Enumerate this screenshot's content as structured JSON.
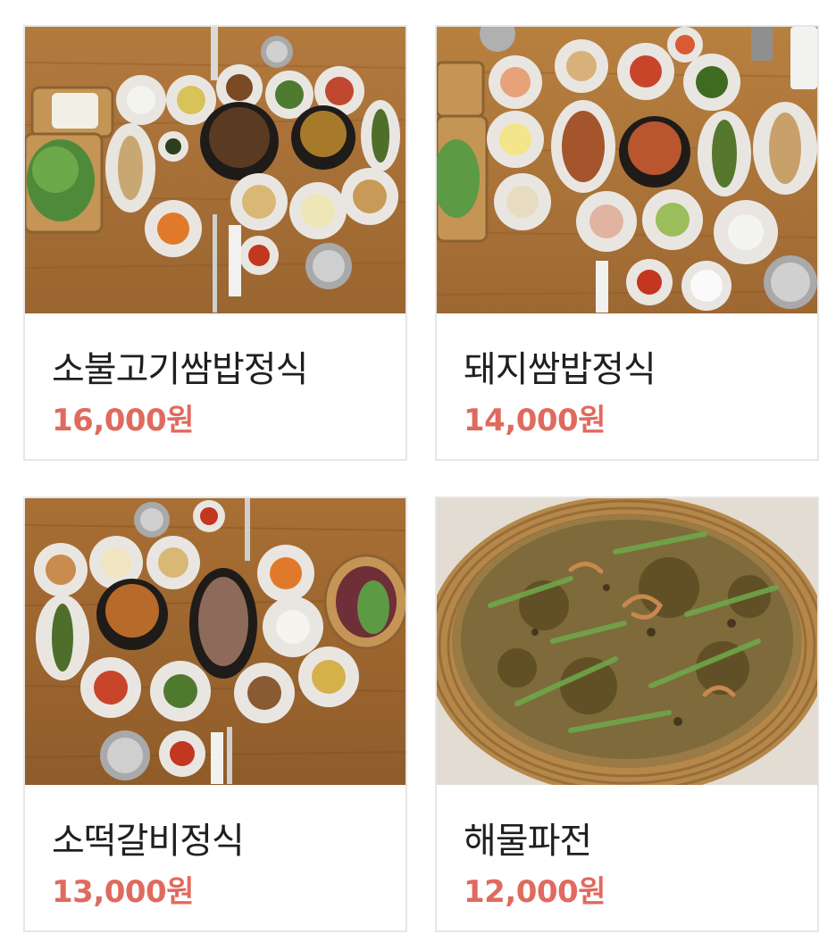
{
  "colors": {
    "price": "#e06a5e",
    "name": "#1f1f1f",
    "card_border": "#e6e6e6",
    "wood_table": "#b07a3c",
    "basket": "#b5884a"
  },
  "menu": [
    {
      "name": "소불고기쌈밥정식",
      "price": "16,000원",
      "photo_icon": "bulgogi-ssambap-set-photo"
    },
    {
      "name": "돼지쌈밥정식",
      "price": "14,000원",
      "photo_icon": "pork-ssambap-set-photo"
    },
    {
      "name": "소떡갈비정식",
      "price": "13,000원",
      "photo_icon": "tteokgalbi-set-photo"
    },
    {
      "name": "해물파전",
      "price": "12,000원",
      "photo_icon": "seafood-pancake-photo"
    }
  ]
}
